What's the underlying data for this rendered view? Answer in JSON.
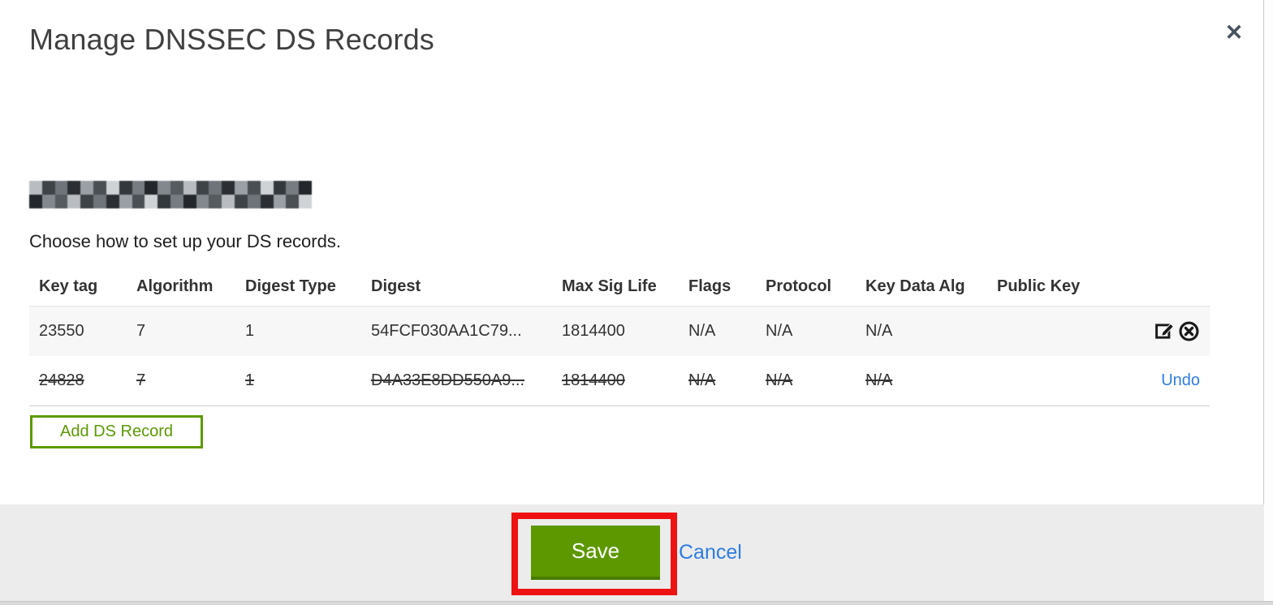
{
  "modal": {
    "title": "Manage DNSSEC DS Records",
    "close_icon": "✕",
    "instruction": "Choose how to set up your DS records.",
    "add_ds_record_label": "Add DS Record",
    "footer": {
      "save_label": "Save",
      "cancel_label": "Cancel"
    }
  },
  "table": {
    "headers": [
      "Key tag",
      "Algorithm",
      "Digest Type",
      "Digest",
      "Max Sig Life",
      "Flags",
      "Protocol",
      "Key Data Alg",
      "Public Key"
    ],
    "rows": [
      {
        "cells": [
          "23550",
          "7",
          "1",
          "54FCF030AA1C79...",
          "1814400",
          "N/A",
          "N/A",
          "N/A",
          ""
        ],
        "state": "normal",
        "action_icons": [
          "edit-icon",
          "delete-icon"
        ]
      },
      {
        "cells": [
          "24828",
          "7",
          "1",
          "D4A33E8DD550A9...",
          "1814400",
          "N/A",
          "N/A",
          "N/A",
          ""
        ],
        "state": "deleted",
        "undo_label": "Undo"
      }
    ]
  },
  "colors": {
    "accent_green": "#5c9a00",
    "accent_green_dark": "#4a7c00",
    "annotation_red": "#ee1212",
    "link_blue": "#2d7ce4",
    "row_stripe": "#f7f7f7",
    "footer_bg": "#ececec",
    "icon_dark": "#1a1a1a"
  }
}
